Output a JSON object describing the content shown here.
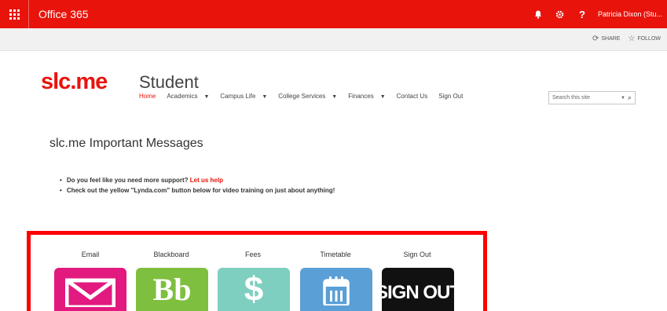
{
  "suite_bar": {
    "brand": "Office 365",
    "user_name": "Patricia Dixon (Stu...",
    "icons": [
      "app-launcher-icon",
      "bell-icon",
      "gear-icon",
      "help-icon"
    ],
    "help_glyph": "?",
    "color": "#e8140c"
  },
  "ribbon": {
    "share_label": "SHARE",
    "follow_label": "FOLLOW"
  },
  "site": {
    "logo": "slc.me",
    "title": "Student"
  },
  "nav": {
    "items": [
      {
        "label": "Home",
        "active": true,
        "dropdown": false
      },
      {
        "label": "Academics",
        "dropdown": true
      },
      {
        "label": "Campus Life",
        "dropdown": true
      },
      {
        "label": "College Services",
        "dropdown": true
      },
      {
        "label": "Finances",
        "dropdown": true
      },
      {
        "label": "Contact Us",
        "dropdown": false
      },
      {
        "label": "Sign Out",
        "dropdown": false
      }
    ]
  },
  "search": {
    "placeholder": "Search this site"
  },
  "page": {
    "title": "slc.me Important Messages",
    "bullets": [
      {
        "text": "Do you feel like you need more support?",
        "link": "Let us help"
      },
      {
        "text": "Check out the yellow \"Lynda.com\" button below for video training on just about anything!"
      }
    ]
  },
  "tiles": [
    {
      "label": "Email",
      "icon": "envelope-icon",
      "color": "#e2197f"
    },
    {
      "label": "Blackboard",
      "icon": "Bb",
      "color": "#7fbf3f"
    },
    {
      "label": "Fees",
      "icon": "$",
      "color": "#7fcfc0"
    },
    {
      "label": "Timetable",
      "icon": "calendar-icon",
      "color": "#5a9fd6"
    },
    {
      "label": "Sign Out",
      "icon": "SIGN OUT",
      "color": "#111111"
    }
  ],
  "highlight_color": "#ff0000"
}
